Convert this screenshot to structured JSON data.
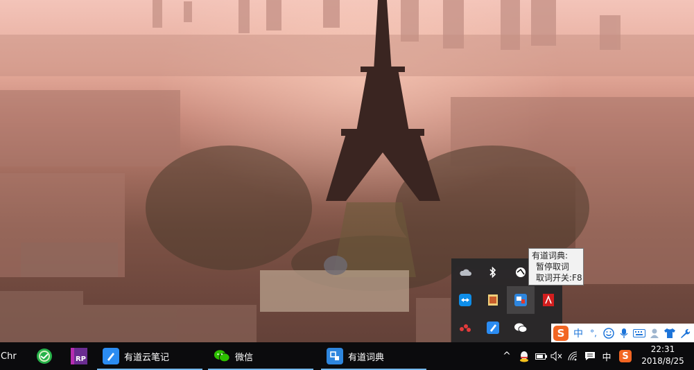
{
  "taskbar": {
    "apps": [
      {
        "label": "Chr",
        "icon": "chrome-icon"
      },
      {
        "label": "",
        "icon": "360-browser-icon"
      },
      {
        "label": "",
        "icon": "axure-rp-icon",
        "icon_text": "RP"
      },
      {
        "label": "有道云笔记",
        "icon": "youdao-note-icon"
      },
      {
        "label": "微信",
        "icon": "wechat-icon"
      },
      {
        "label": "有道词典",
        "icon": "youdao-dict-icon"
      }
    ],
    "tray": {
      "chevron": "^",
      "ime_label": "中",
      "clock_time": "22:31",
      "clock_date": "2018/8/25"
    }
  },
  "flyout": {
    "icons": [
      "onedrive-icon",
      "bluetooth-icon",
      "network-monitor-icon",
      "",
      "teamviewer-icon",
      "notepad-icon",
      "youdao-dict-tray-icon",
      "adobe-icon",
      "dots-app-icon",
      "youdao-note-tray-icon",
      "wechat-tray-icon",
      ""
    ]
  },
  "tooltip": {
    "line1": "有道词典:",
    "line2": "暂停取词",
    "line3": "取词开关:F8"
  },
  "ime_bar": {
    "logo": "S",
    "lang": "中",
    "punct": "°,",
    "colors": {
      "accent": "#1c74d9",
      "logo": "#f26522"
    }
  },
  "colors": {
    "taskbar": "#0b0b0d",
    "active_underline": "#76b9ed",
    "wechat": "#2dc100",
    "youdao_note": "#2b8cf2",
    "youdao_dict": "#2e86de",
    "axure": "#6a2c91"
  }
}
